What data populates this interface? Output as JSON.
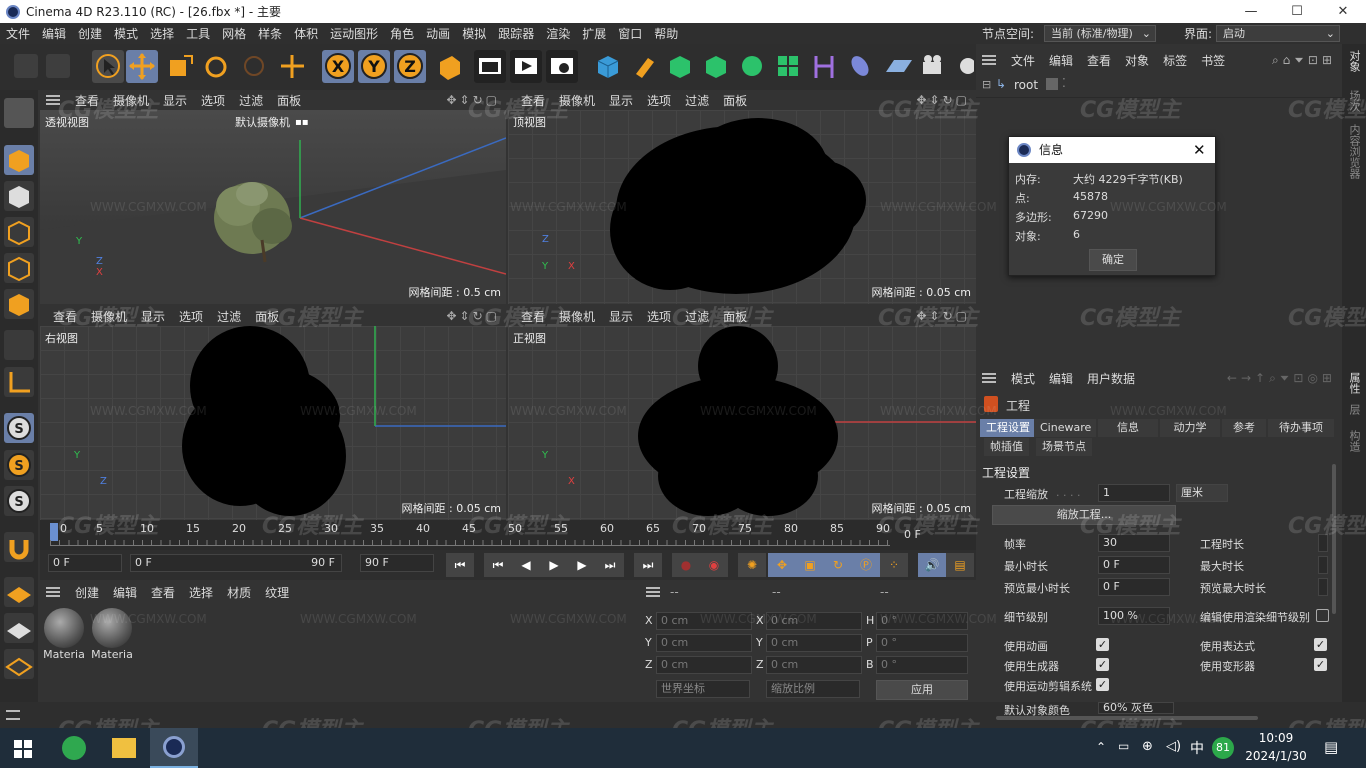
{
  "title": "Cinema 4D R23.110 (RC) - [26.fbx *] - 主要",
  "window_controls": {
    "min": "—",
    "max": "☐",
    "close": "✕"
  },
  "menu": [
    "文件",
    "编辑",
    "创建",
    "模式",
    "选择",
    "工具",
    "网格",
    "样条",
    "体积",
    "运动图形",
    "角色",
    "动画",
    "模拟",
    "跟踪器",
    "渲染",
    "扩展",
    "窗口",
    "帮助"
  ],
  "node_space_label": "节点空间:",
  "node_space_value": "当前 (标准/物理)",
  "layout_label": "界面:",
  "layout_value": "启动",
  "viewports": [
    {
      "name": "透视视图",
      "camera": "默认摄像机",
      "grid": "网格间距 : 0.5 cm"
    },
    {
      "name": "顶视图",
      "grid": "网格间距 : 0.05 cm"
    },
    {
      "name": "右视图",
      "grid": "网格间距 : 0.05 cm"
    },
    {
      "name": "正视图",
      "grid": "网格间距 : 0.05 cm"
    }
  ],
  "viewport_menu": [
    "查看",
    "摄像机",
    "显示",
    "选项",
    "过滤",
    "面板"
  ],
  "axis": {
    "x": "X",
    "y": "Y",
    "z": "Z"
  },
  "timeline": {
    "ticks": [
      "0",
      "5",
      "10",
      "15",
      "20",
      "25",
      "30",
      "35",
      "40",
      "45",
      "50",
      "55",
      "60",
      "65",
      "70",
      "75",
      "80",
      "85",
      "90"
    ],
    "end_label": "0 F"
  },
  "transport": {
    "start": "0 F",
    "range_start": "0 F",
    "range_end": "90 F",
    "end": "90 F"
  },
  "material_manager": {
    "menu": [
      "创建",
      "编辑",
      "查看",
      "选择",
      "材质",
      "纹理"
    ],
    "materials": [
      "Materia",
      "Materia"
    ]
  },
  "coords": {
    "headers": [
      "--",
      "--",
      "--"
    ],
    "rows": [
      {
        "a": "X",
        "av": "0 cm",
        "b": "X",
        "bv": "0 cm",
        "c": "H",
        "cv": "0 °"
      },
      {
        "a": "Y",
        "av": "0 cm",
        "b": "Y",
        "bv": "0 cm",
        "c": "P",
        "cv": "0 °"
      },
      {
        "a": "Z",
        "av": "0 cm",
        "b": "Z",
        "bv": "0 cm",
        "c": "B",
        "cv": "0 °"
      }
    ],
    "world": "世界坐标",
    "scale": "缩放比例",
    "apply": "应用"
  },
  "object_manager": {
    "menu": [
      "文件",
      "编辑",
      "查看",
      "对象",
      "标签",
      "书签"
    ],
    "root": "root"
  },
  "info_dialog": {
    "title": "信息",
    "rows": [
      {
        "k": "内存:",
        "v": "大约 4229千字节(KB)"
      },
      {
        "k": "点:",
        "v": "45878"
      },
      {
        "k": "多边形:",
        "v": "67290"
      },
      {
        "k": "对象:",
        "v": "6"
      }
    ],
    "ok": "确定"
  },
  "attributes": {
    "menu": [
      "模式",
      "编辑",
      "用户数据"
    ],
    "project": "工程",
    "tabs1": [
      "工程设置",
      "Cineware",
      "信息",
      "动力学",
      "参考",
      "待办事项"
    ],
    "tabs2": [
      "帧插值",
      "场景节点"
    ],
    "section": "工程设置",
    "scale_label": "工程缩放",
    "scale_value": "1",
    "scale_unit": "厘米",
    "scale_btn": "缩放工程...",
    "fps_label": "帧率",
    "fps_value": "30",
    "proj_len_label": "工程时长",
    "min_label": "最小时长",
    "min_value": "0 F",
    "max_label": "最大时长",
    "pmin_label": "预览最小时长",
    "pmin_value": "0 F",
    "pmax_label": "预览最大时长",
    "lod_label": "细节级别",
    "lod_value": "100 %",
    "render_lod_label": "编辑使用渲染细节级别",
    "use_anim": "使用动画",
    "use_expr": "使用表达式",
    "use_gen": "使用生成器",
    "use_deform": "使用变形器",
    "use_motion": "使用运动剪辑系统",
    "default_color_label": "默认对象颜色",
    "default_color_value": "60% 灰色"
  },
  "sidebar_tabs": [
    "对象",
    "场次",
    "内容浏览器",
    "属性",
    "层",
    "构造"
  ],
  "taskbar": {
    "time": "10:09",
    "date": "2024/1/30",
    "ime": "中",
    "badge": "81"
  },
  "watermark_logo": "CG模型主",
  "watermark_url": "WWW.CGMXW.COM"
}
